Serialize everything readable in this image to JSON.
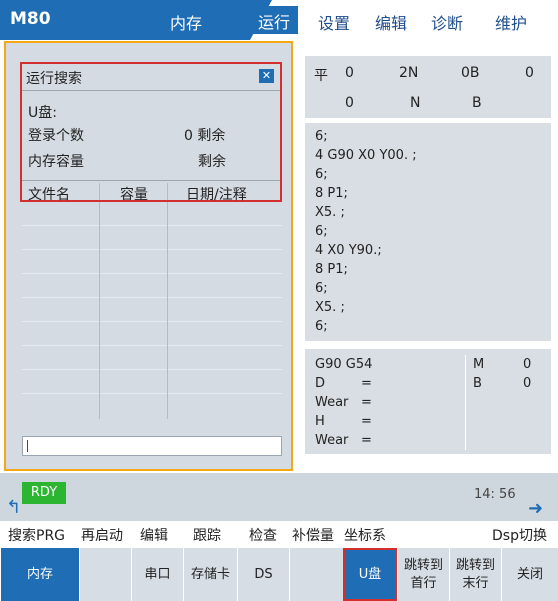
{
  "header": {
    "model": "M80",
    "mode": "内存",
    "tabs": [
      "运行",
      "设置",
      "编辑",
      "诊断",
      "维护"
    ]
  },
  "search": {
    "title": "运行搜索",
    "drive_label": "U盘:",
    "login_count_label": "登录个数",
    "login_count_value": "0 剩余",
    "capacity_label": "内存容量",
    "capacity_value": "剩余",
    "columns": [
      "文件名",
      "容量",
      "日期/注释"
    ]
  },
  "position": {
    "row1": [
      "平",
      "0",
      "2N",
      "0B",
      "0"
    ],
    "row2": [
      "0",
      "N",
      "B"
    ]
  },
  "program": [
    "6;",
    "4 G90 X0 Y00. ;",
    "6;",
    "8 P1;",
    "X5. ;",
    "6;",
    "4 X0 Y90.;",
    "8 P1;",
    "6;",
    "X5. ;",
    "6;"
  ],
  "modal": {
    "gcodes": "G90 G54",
    "d_label": "D",
    "d_eq": "=",
    "wear1_label": "Wear",
    "wear1_eq": "=",
    "h_label": "H",
    "h_eq": "=",
    "wear2_label": "Wear",
    "wear2_eq": "=",
    "m_label": "M",
    "m_value": "0",
    "b_label": "B",
    "b_value": "0"
  },
  "status": {
    "ready": "RDY",
    "time": "14: 56"
  },
  "softkey_labels": [
    "搜索PRG",
    "再启动",
    "编辑",
    "跟踪",
    "检查",
    "补偿量",
    "坐标系",
    "Dsp切换"
  ],
  "buttons": {
    "memory": "内存",
    "serial": "串口",
    "card": "存储卡",
    "ds": "DS",
    "usb": "U盘",
    "jump_first_1": "跳转到",
    "jump_first_2": "首行",
    "jump_last_1": "跳转到",
    "jump_last_2": "末行",
    "close": "关闭"
  },
  "colors": {
    "accent": "#1f6db5",
    "highlight": "#d32f2f",
    "ready": "#2bb530",
    "panel_border": "#f3a81a"
  }
}
